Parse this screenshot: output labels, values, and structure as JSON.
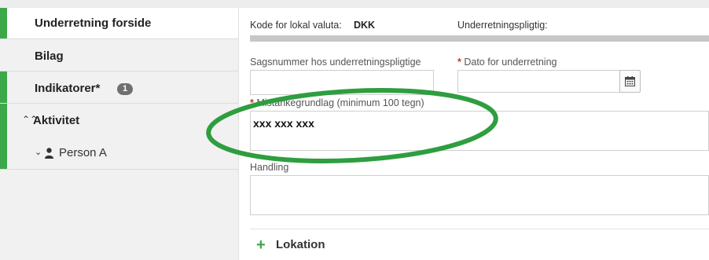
{
  "sidebar": {
    "items": [
      {
        "label": "Underretning forside"
      },
      {
        "label": "Bilag"
      },
      {
        "label": "Indikatorer*",
        "badge": "1"
      },
      {
        "label": "Aktivitet"
      },
      {
        "label": "Person A"
      }
    ]
  },
  "form": {
    "currency_label": "Kode for lokal valuta:",
    "currency_value": "DKK",
    "reporter_label": "Underretningspligtig:",
    "case_number_label": "Sagsnummer hos underretningspligtige",
    "case_number_value": "",
    "date_label": "Dato for underretning",
    "date_value": "",
    "required_marker": "*",
    "suspicion_label": "Mistankegrundlag (minimum 100 tegn)",
    "suspicion_value": "xxx xxx xxx",
    "action_label": "Handling",
    "action_value": "",
    "location_label": "Lokation",
    "location_plus": "+"
  },
  "colors": {
    "accent_green": "#3ca849",
    "annotation_green": "#2e9e3f",
    "required_red": "#c0392b",
    "badge_grey": "#6f6f6f"
  },
  "icons": {
    "calendar": "calendar-icon",
    "person": "person-icon",
    "chevron_up": "double-chevron-up-icon",
    "chevron_down": "chevron-down-icon",
    "plus": "plus-icon"
  }
}
